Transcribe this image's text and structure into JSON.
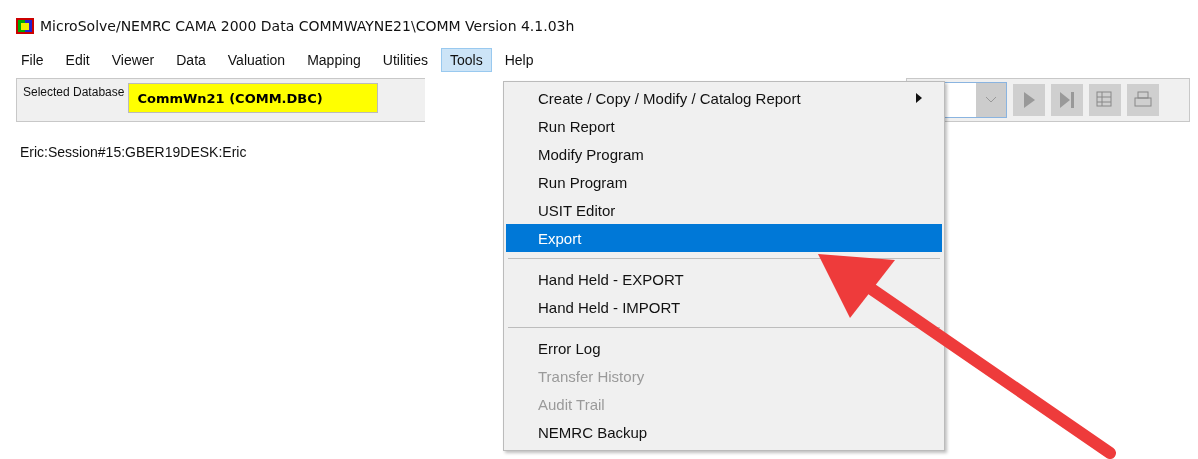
{
  "window": {
    "title": "MicroSolve/NEMRC CAMA 2000  Data COMMWAYNE21\\COMM Version 4.1.03h"
  },
  "menu_bar": [
    {
      "label": "File",
      "selected": false
    },
    {
      "label": "Edit",
      "selected": false
    },
    {
      "label": "Viewer",
      "selected": false
    },
    {
      "label": "Data",
      "selected": false
    },
    {
      "label": "Valuation",
      "selected": false
    },
    {
      "label": "Mapping",
      "selected": false
    },
    {
      "label": "Utilities",
      "selected": false
    },
    {
      "label": "Tools",
      "selected": true
    },
    {
      "label": "Help",
      "selected": false
    }
  ],
  "toolbar": {
    "database_label": "Selected Database",
    "database_value": "CommWn21   (COMM.DBC)"
  },
  "session": "Eric:Session#15:GBER19DESK:Eric",
  "tools_menu": [
    {
      "kind": "item",
      "label": "Create / Copy / Modify / Catalog Report",
      "submenu": true,
      "disabled": false,
      "selected": false
    },
    {
      "kind": "item",
      "label": "Run Report",
      "submenu": false,
      "disabled": false,
      "selected": false
    },
    {
      "kind": "item",
      "label": "Modify Program",
      "submenu": false,
      "disabled": false,
      "selected": false
    },
    {
      "kind": "item",
      "label": "Run Program",
      "submenu": false,
      "disabled": false,
      "selected": false
    },
    {
      "kind": "item",
      "label": "USIT Editor",
      "submenu": false,
      "disabled": false,
      "selected": false
    },
    {
      "kind": "item",
      "label": "Export",
      "submenu": false,
      "disabled": false,
      "selected": true
    },
    {
      "kind": "separator"
    },
    {
      "kind": "item",
      "label": "Hand Held - EXPORT",
      "submenu": false,
      "disabled": false,
      "selected": false
    },
    {
      "kind": "item",
      "label": "Hand Held - IMPORT",
      "submenu": false,
      "disabled": false,
      "selected": false
    },
    {
      "kind": "separator"
    },
    {
      "kind": "item",
      "label": "Error Log",
      "submenu": false,
      "disabled": false,
      "selected": false
    },
    {
      "kind": "item",
      "label": "Transfer History",
      "submenu": false,
      "disabled": true,
      "selected": false
    },
    {
      "kind": "item",
      "label": "Audit Trail",
      "submenu": false,
      "disabled": true,
      "selected": false
    },
    {
      "kind": "item",
      "label": "NEMRC Backup",
      "submenu": false,
      "disabled": false,
      "selected": false
    }
  ]
}
